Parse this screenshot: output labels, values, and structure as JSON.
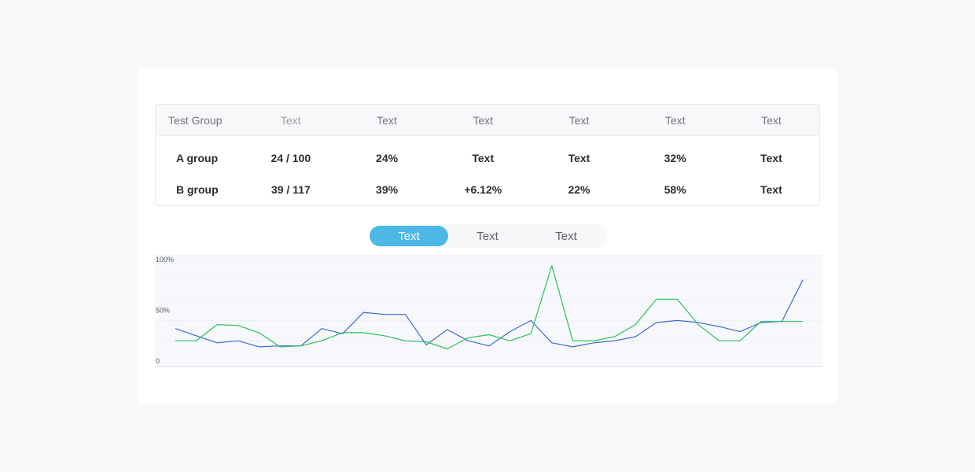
{
  "table": {
    "headers": [
      "Test Group",
      "Text",
      "Text",
      "Text",
      "Text",
      "Text",
      "Text"
    ],
    "rows": [
      [
        "A group",
        "24 / 100",
        "24%",
        "Text",
        "Text",
        "32%",
        "Text"
      ],
      [
        "B group",
        "39 / 117",
        "39%",
        "+6.12%",
        "22%",
        "58%",
        "Text"
      ]
    ]
  },
  "segmented": {
    "options": [
      "Text",
      "Text",
      "Text"
    ],
    "active_index": 0,
    "active_color": "#4db8e6"
  },
  "chart_data": {
    "type": "line",
    "y_ticks": [
      "100%",
      "50%",
      "0"
    ],
    "ylim": [
      0,
      100
    ],
    "grid": true,
    "series": [
      {
        "color": "#3f67dd",
        "x": [
          0,
          1,
          2,
          3,
          4,
          5,
          6,
          7,
          8,
          9,
          10,
          11,
          12,
          13,
          14,
          15,
          16,
          17,
          18,
          19,
          20,
          21,
          22,
          23,
          24,
          25,
          26,
          27,
          28,
          29,
          30
        ],
        "values": [
          32,
          25,
          18,
          20,
          14,
          15,
          15,
          32,
          27,
          48,
          46,
          46,
          16,
          31,
          20,
          15,
          29,
          40,
          18,
          14,
          18,
          20,
          24,
          38,
          40,
          38,
          34,
          29,
          38,
          39,
          80
        ]
      },
      {
        "color": "#27c25a",
        "x": [
          0,
          1,
          2,
          3,
          4,
          5,
          6,
          7,
          8,
          9,
          10,
          11,
          12,
          13,
          14,
          15,
          16,
          17,
          18,
          19,
          20,
          21,
          22,
          23,
          24,
          25,
          26,
          27,
          28,
          29,
          30
        ],
        "values": [
          20,
          20,
          36,
          35,
          28,
          14,
          15,
          20,
          28,
          28,
          25,
          20,
          19,
          12,
          23,
          26,
          20,
          27,
          94,
          20,
          20,
          24,
          36,
          61,
          61,
          36,
          20,
          20,
          39,
          39,
          39
        ]
      }
    ]
  }
}
